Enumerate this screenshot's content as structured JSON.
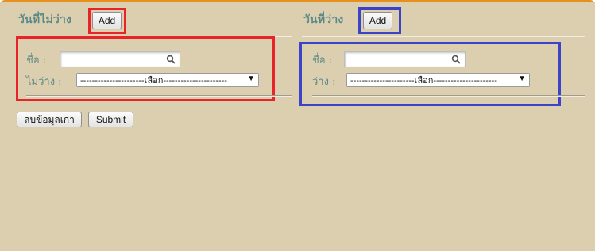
{
  "left": {
    "title": "วันที่ไม่ว่าง",
    "add_label": "Add",
    "name_label": "ชื่อ  :",
    "status_label": "ไม่ว่าง  :",
    "select_value": "----------------------เลือก----------------------",
    "delete_label": "ลบข้อมูลเก่า",
    "submit_label": "Submit"
  },
  "right": {
    "title": "วันที่ว่าง",
    "add_label": "Add",
    "name_label": "ชื่อ  :",
    "status_label": "ว่าง  :",
    "select_value": "----------------------เลือก----------------------"
  },
  "colors": {
    "panel_bg": "#dccfb0",
    "heading": "#5b8a86",
    "highlight_left": "#e8232a",
    "highlight_right": "#3d43c8",
    "top_border": "#e8901e"
  },
  "icons": {
    "search": "search-icon",
    "dropdown": "chevron-down-icon"
  }
}
